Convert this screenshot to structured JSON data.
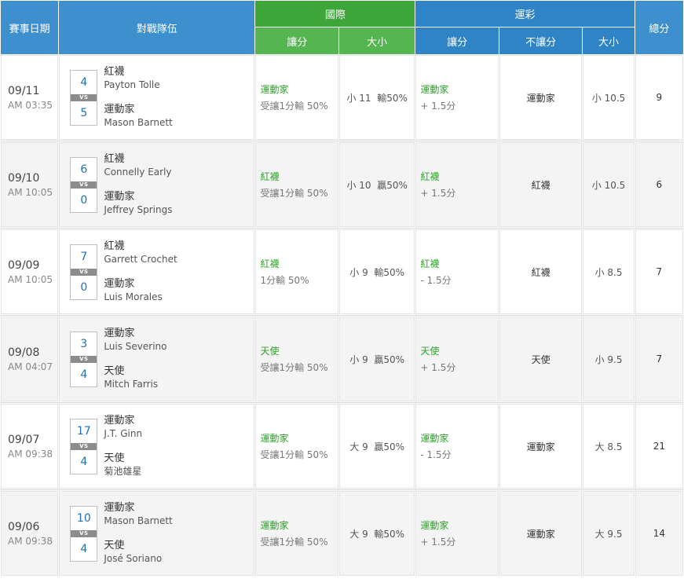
{
  "headers": {
    "date": "賽事日期",
    "teams": "對戰隊伍",
    "intl": "國際",
    "sports_lottery": "運彩",
    "handicap": "讓分",
    "over_under": "大小",
    "no_handicap": "不讓分",
    "total": "總分"
  },
  "vs_label": "VS",
  "games": [
    {
      "date": "09/11",
      "time": "AM 03:35",
      "away_score": "4",
      "away_team": "紅襪",
      "away_pitcher": "Payton Tolle",
      "home_score": "5",
      "home_team": "運動家",
      "home_pitcher": "Mason Barnett",
      "intl_hcp_team": "運動家",
      "intl_hcp_detail": "受讓1分輸 50%",
      "intl_ou": "小 11  輸50%",
      "lot_hcp_team": "運動家",
      "lot_hcp_detail": "+ 1.5分",
      "lot_nohcp": "運動家",
      "lot_ou": "小 10.5",
      "total": "9"
    },
    {
      "date": "09/10",
      "time": "AM 10:05",
      "away_score": "6",
      "away_team": "紅襪",
      "away_pitcher": "Connelly Early",
      "home_score": "0",
      "home_team": "運動家",
      "home_pitcher": "Jeffrey Springs",
      "intl_hcp_team": "紅襪",
      "intl_hcp_detail": "受讓1分輸 50%",
      "intl_ou": "小 10  贏50%",
      "lot_hcp_team": "紅襪",
      "lot_hcp_detail": "+ 1.5分",
      "lot_nohcp": "紅襪",
      "lot_ou": "小 10.5",
      "total": "6"
    },
    {
      "date": "09/09",
      "time": "AM 10:05",
      "away_score": "7",
      "away_team": "紅襪",
      "away_pitcher": "Garrett Crochet",
      "home_score": "0",
      "home_team": "運動家",
      "home_pitcher": "Luis Morales",
      "intl_hcp_team": "紅襪",
      "intl_hcp_detail": "1分輸 50%",
      "intl_ou": "小 9  輸50%",
      "lot_hcp_team": "紅襪",
      "lot_hcp_detail": "- 1.5分",
      "lot_nohcp": "紅襪",
      "lot_ou": "小 8.5",
      "total": "7"
    },
    {
      "date": "09/08",
      "time": "AM 04:07",
      "away_score": "3",
      "away_team": "運動家",
      "away_pitcher": "Luis Severino",
      "home_score": "4",
      "home_team": "天使",
      "home_pitcher": "Mitch Farris",
      "intl_hcp_team": "天使",
      "intl_hcp_detail": "受讓1分輸 50%",
      "intl_ou": "小 9  贏50%",
      "lot_hcp_team": "天使",
      "lot_hcp_detail": "+ 1.5分",
      "lot_nohcp": "天使",
      "lot_ou": "小 9.5",
      "total": "7"
    },
    {
      "date": "09/07",
      "time": "AM 09:38",
      "away_score": "17",
      "away_team": "運動家",
      "away_pitcher": "J.T. Ginn",
      "home_score": "4",
      "home_team": "天使",
      "home_pitcher": "菊池雄星",
      "intl_hcp_team": "運動家",
      "intl_hcp_detail": "受讓1分輸 50%",
      "intl_ou": "大 9  贏50%",
      "lot_hcp_team": "運動家",
      "lot_hcp_detail": "- 1.5分",
      "lot_nohcp": "運動家",
      "lot_ou": "大 8.5",
      "total": "21"
    },
    {
      "date": "09/06",
      "time": "AM 09:38",
      "away_score": "10",
      "away_team": "運動家",
      "away_pitcher": "Mason Barnett",
      "home_score": "4",
      "home_team": "天使",
      "home_pitcher": "José Soriano",
      "intl_hcp_team": "運動家",
      "intl_hcp_detail": "受讓1分輸 50%",
      "intl_ou": "大 9  輸50%",
      "lot_hcp_team": "運動家",
      "lot_hcp_detail": "+ 1.5分",
      "lot_nohcp": "運動家",
      "lot_ou": "大 9.5",
      "total": "14"
    }
  ]
}
